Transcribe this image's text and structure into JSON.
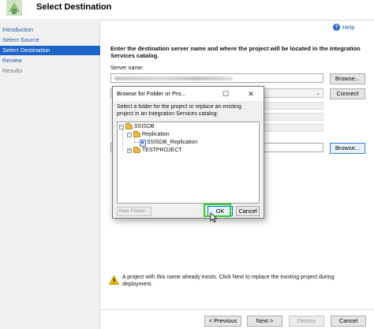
{
  "header": {
    "title": "Select Destination"
  },
  "sidebar": {
    "items": [
      {
        "label": "Introduction",
        "state": "link"
      },
      {
        "label": "Select Source",
        "state": "link"
      },
      {
        "label": "Select Destination",
        "state": "active"
      },
      {
        "label": "Review",
        "state": "link"
      },
      {
        "label": "Results",
        "state": "disabled"
      }
    ]
  },
  "main": {
    "help_label": "Help",
    "instructions": "Enter the destination server name and where the project will be located in the Integration Services catalog.",
    "server_label": "Server name:",
    "browse_label": "Browse...",
    "connect_label": "Connect",
    "path_browse_label": "Browse...",
    "warning": "A project with this name already exists. Click Next to replace the existing project during deployment."
  },
  "dialog": {
    "title": "Browse for Folder or Pro...",
    "instructions": "Select a folder for the project or replace an existing project in an Integration Services catalog:",
    "tree": {
      "root": "SSISDB",
      "folders": [
        {
          "label": "Replication",
          "children": [
            "SSISDB_Replication"
          ]
        },
        {
          "label": "TESTPROJECT",
          "children": []
        }
      ]
    },
    "new_folder_label": "New Folder...",
    "ok_label": "OK",
    "cancel_label": "Cancel"
  },
  "footer": {
    "previous_label": "< Previous",
    "next_label": "Next >",
    "deploy_label": "Deploy",
    "cancel_label": "Cancel"
  },
  "colors": {
    "accent": "#1c64c8",
    "link": "#1f5fa8",
    "highlight": "#2fd12f",
    "warning": "#f2c200"
  },
  "icons": [
    "wizard-logo-icon",
    "help-icon",
    "warning-icon",
    "folder-icon",
    "project-icon",
    "maximize-icon",
    "close-icon",
    "cursor-icon"
  ]
}
